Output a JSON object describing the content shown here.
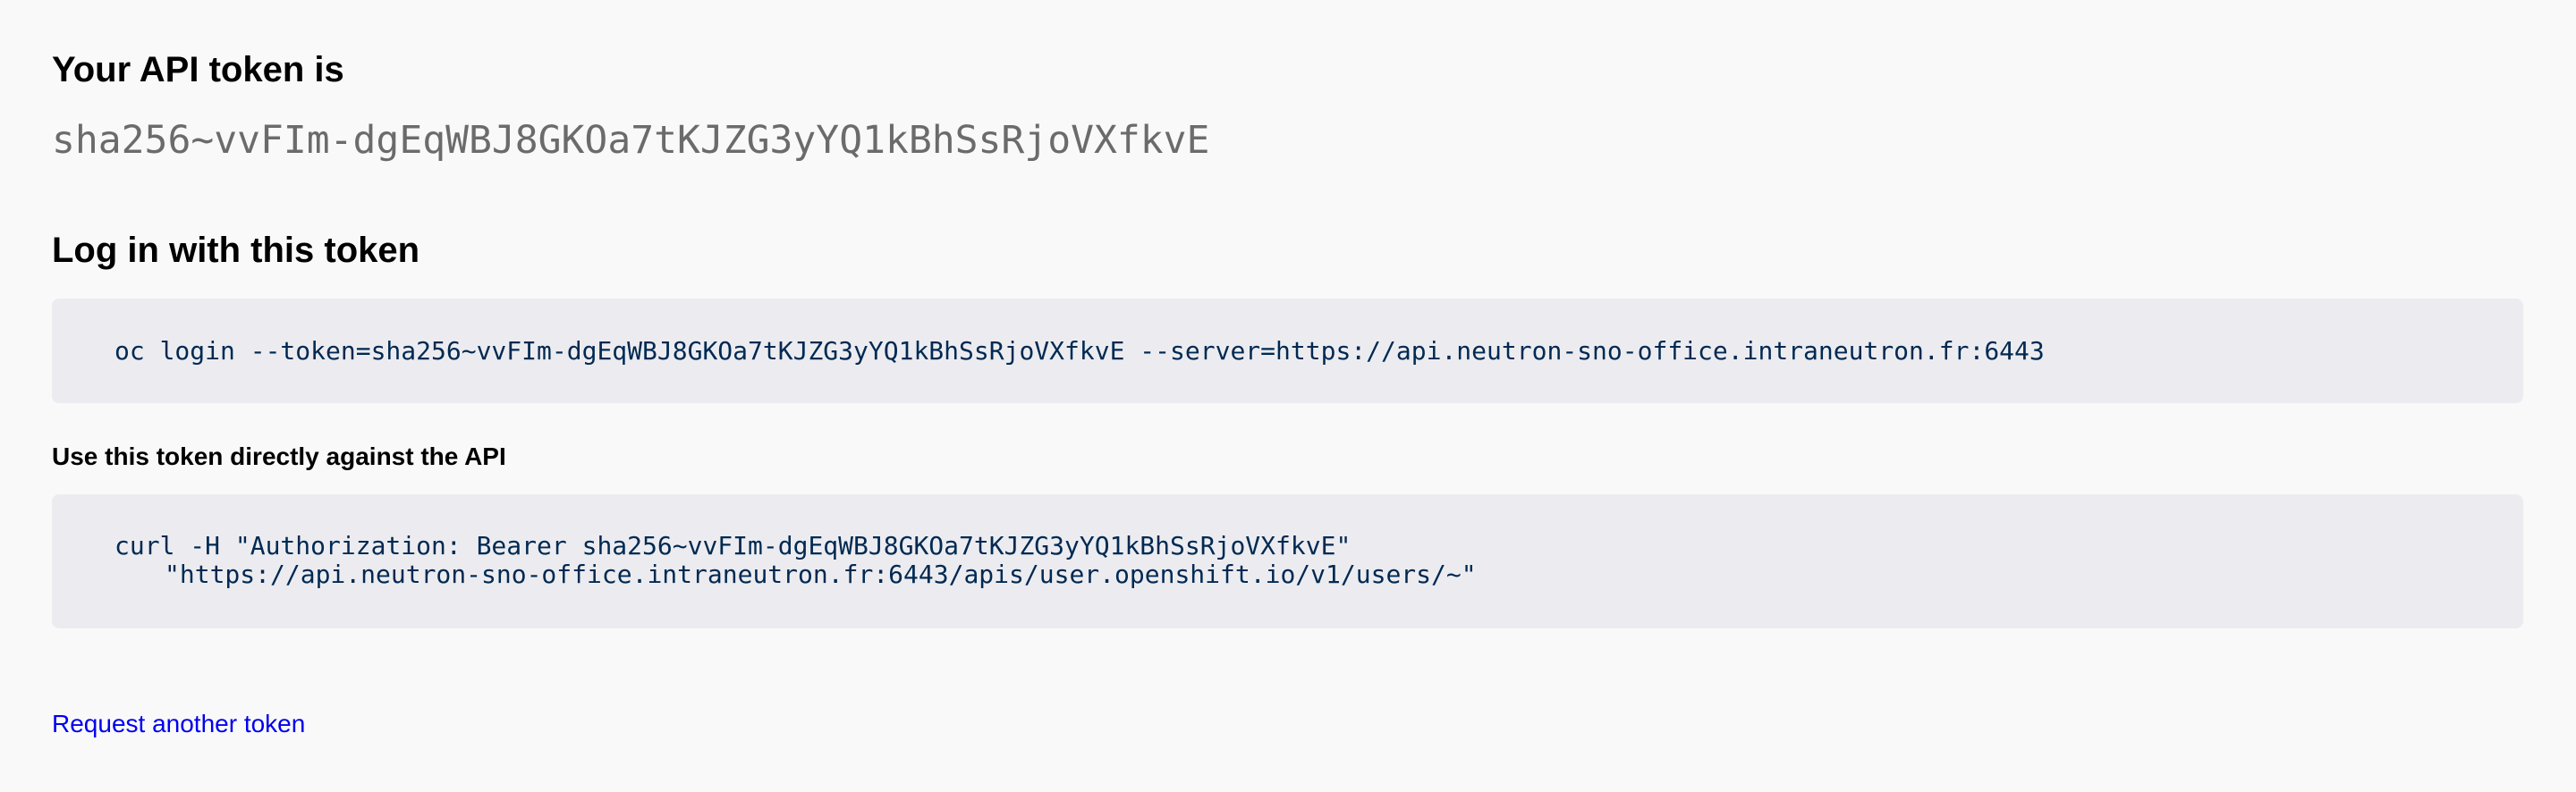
{
  "token_section": {
    "title": "Your API token is",
    "token": "sha256~vvFIm-dgEqWBJ8GKOa7tKJZG3yYQ1kBhSsRjoVXfkvE"
  },
  "login_section": {
    "title": "Log in with this token",
    "command": "oc login --token=sha256~vvFIm-dgEqWBJ8GKOa7tKJZG3yYQ1kBhSsRjoVXfkvE --server=https://api.neutron-sno-office.intraneutron.fr:6443"
  },
  "api_section": {
    "title": "Use this token directly against the API",
    "command_line1": "curl -H \"Authorization: Bearer sha256~vvFIm-dgEqWBJ8GKOa7tKJZG3yYQ1kBhSsRjoVXfkvE\"",
    "command_line2": "\"https://api.neutron-sno-office.intraneutron.fr:6443/apis/user.openshift.io/v1/users/~\""
  },
  "footer": {
    "request_link": "Request another token"
  }
}
